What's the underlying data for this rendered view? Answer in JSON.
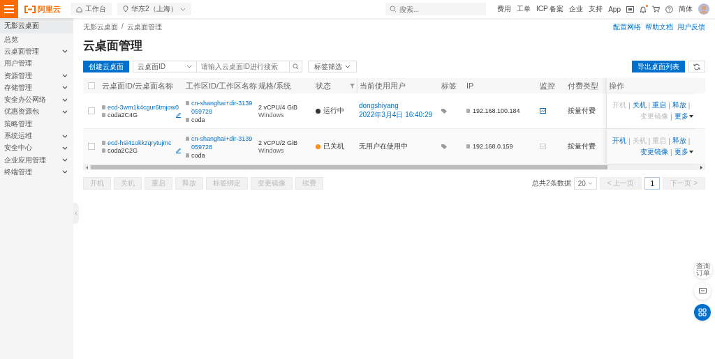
{
  "topbar": {
    "logo": "阿里云",
    "workbench": "工作台",
    "region": "华东2（上海）",
    "search": {
      "placeholder": "搜索..."
    },
    "links": [
      "费用",
      "工单",
      "ICP 备案",
      "企业",
      "支持",
      "App"
    ],
    "notification_dot": true,
    "language": "简体"
  },
  "sidebar": {
    "title": "无影云桌面",
    "items": [
      {
        "label": "总览",
        "kind": "link"
      },
      {
        "label": "云桌面管理",
        "kind": "group"
      },
      {
        "label": "用户管理",
        "kind": "link"
      },
      {
        "label": "资源管理",
        "kind": "group"
      },
      {
        "label": "存储管理",
        "kind": "group"
      },
      {
        "label": "安全办公网络",
        "kind": "group"
      },
      {
        "label": "优惠资源包",
        "kind": "group"
      },
      {
        "label": "策略管理",
        "kind": "link"
      },
      {
        "label": "系统运维",
        "kind": "group"
      },
      {
        "label": "安全中心",
        "kind": "group"
      },
      {
        "label": "企业应用管理",
        "kind": "group"
      },
      {
        "label": "终端管理",
        "kind": "group"
      }
    ]
  },
  "breadcrumb": [
    "无影云桌面",
    "云桌面管理"
  ],
  "breadcrumb_separator": "/",
  "header_links": [
    "配置网络",
    "帮助文档",
    "用户反馈"
  ],
  "page_title": "云桌面管理",
  "toolbar": {
    "create": "创建云桌面",
    "filter_field": "云桌面ID",
    "search": {
      "placeholder": "请输入云桌面ID进行搜索"
    },
    "tag_filter": "标签筛选",
    "export": "导出桌面列表"
  },
  "table": {
    "select_all_checked": false,
    "action_separator": "|",
    "columns": [
      "云桌面ID/云桌面名称",
      "工作区ID/工作区名称",
      "规格/系统",
      "状态",
      "当前使用用户",
      "标签",
      "IP",
      "监控",
      "付费类型",
      "操作"
    ],
    "rows": [
      {
        "checked": false,
        "id": "ecd-3wm1k4cgur6tmjow0",
        "name": "coda2C4G",
        "workspace_id": "cn-shanghai+dir-3139059728",
        "workspace_name": "coda",
        "spec": "2 vCPU/4 GiB",
        "os": "Windows",
        "status": {
          "label": "运行中",
          "color": "#333333"
        },
        "user": "dongshiyang",
        "user_time": "2022年3月4日 16:40:29",
        "ip": "192.168.100.184",
        "monitor_enabled": true,
        "billing": "按量付费",
        "actions": [
          {
            "label": "开机",
            "disabled": true
          },
          {
            "label": "关机",
            "disabled": false
          },
          {
            "label": "重启",
            "disabled": false
          },
          {
            "label": "释放",
            "disabled": false
          },
          {
            "label": "变更镜像",
            "disabled": true
          },
          {
            "label": "更多",
            "disabled": false
          }
        ]
      },
      {
        "checked": false,
        "id": "ecd-hsi41okkzqrytujmc",
        "name": "coda2C2G",
        "workspace_id": "cn-shanghai+dir-3139059728",
        "workspace_name": "coda",
        "spec": "2 vCPU/2 GiB",
        "os": "Windows",
        "status": {
          "label": "已关机",
          "color": "#f98e1a"
        },
        "user": "无用户在使用中",
        "ip": "192.168.0.159",
        "monitor_enabled": false,
        "billing": "按量付费",
        "actions": [
          {
            "label": "开机",
            "disabled": false
          },
          {
            "label": "关机",
            "disabled": true
          },
          {
            "label": "重启",
            "disabled": true
          },
          {
            "label": "释放",
            "disabled": false
          },
          {
            "label": "变更镜像",
            "disabled": false
          },
          {
            "label": "更多",
            "disabled": false
          }
        ]
      }
    ]
  },
  "batch_buttons": [
    {
      "label": "开机",
      "disabled": true
    },
    {
      "label": "关机",
      "disabled": true
    },
    {
      "label": "重启",
      "disabled": true
    },
    {
      "label": "释放",
      "disabled": true
    },
    {
      "label": "标签绑定",
      "disabled": true
    },
    {
      "label": "变更镜像",
      "disabled": true
    },
    {
      "label": "续费",
      "disabled": true
    }
  ],
  "pagination": {
    "total": "总共2条数据",
    "page_size": "20",
    "prev": "< 上一页",
    "page": "1",
    "next": "下一页 >"
  },
  "float_buttons": {
    "order": "查询订单"
  }
}
